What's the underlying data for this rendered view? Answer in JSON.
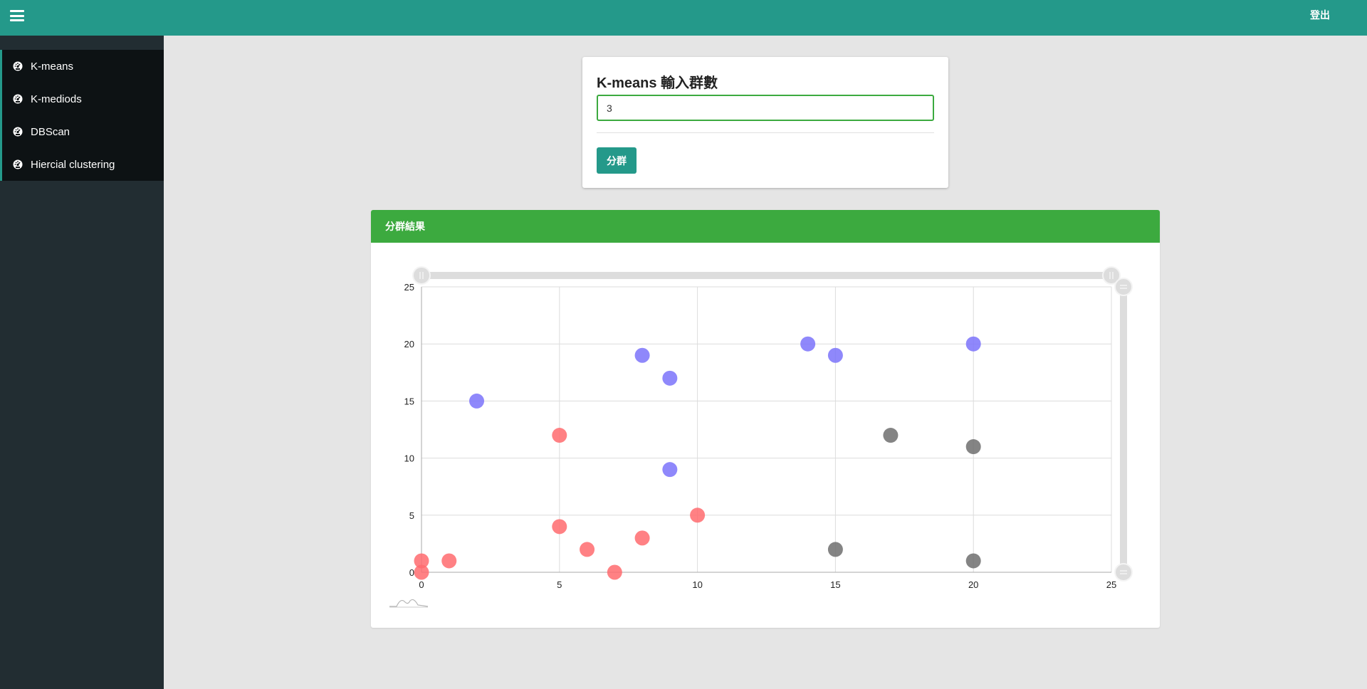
{
  "topbar": {
    "logout_label": "登出",
    "color": "#24998a"
  },
  "sidebar": {
    "items": [
      {
        "label": "K-means",
        "icon": "dashboard-icon"
      },
      {
        "label": "K-mediods",
        "icon": "dashboard-icon"
      },
      {
        "label": "DBScan",
        "icon": "dashboard-icon"
      },
      {
        "label": "Hiercial clustering",
        "icon": "dashboard-icon"
      }
    ]
  },
  "form": {
    "title": "K-means 輸入群數",
    "input_value": "3",
    "button_label": "分群"
  },
  "result": {
    "header": "分群結果",
    "header_color": "#3caa3f"
  },
  "chart_data": {
    "type": "scatter",
    "xlim": [
      0,
      25
    ],
    "ylim": [
      0,
      25
    ],
    "x_ticks": [
      "0",
      "5",
      "10",
      "15",
      "20",
      "25"
    ],
    "y_ticks": [
      "0",
      "5",
      "10",
      "15",
      "20",
      "25"
    ],
    "grid": true,
    "series": [
      {
        "color": "#ff6b6e",
        "points": [
          [
            0,
            1
          ],
          [
            0,
            0
          ],
          [
            1,
            1
          ],
          [
            5,
            12
          ],
          [
            5,
            4
          ],
          [
            6,
            2
          ],
          [
            7,
            0
          ],
          [
            8,
            3
          ],
          [
            10,
            5
          ]
        ]
      },
      {
        "color": "#7b73fa",
        "points": [
          [
            2,
            15
          ],
          [
            8,
            19
          ],
          [
            9,
            17
          ],
          [
            9,
            9
          ],
          [
            14,
            20
          ],
          [
            15,
            19
          ],
          [
            20,
            20
          ]
        ]
      },
      {
        "color": "#6e6e6e",
        "points": [
          [
            17,
            12
          ],
          [
            20,
            11
          ],
          [
            15,
            2
          ],
          [
            20,
            1
          ]
        ]
      }
    ]
  }
}
